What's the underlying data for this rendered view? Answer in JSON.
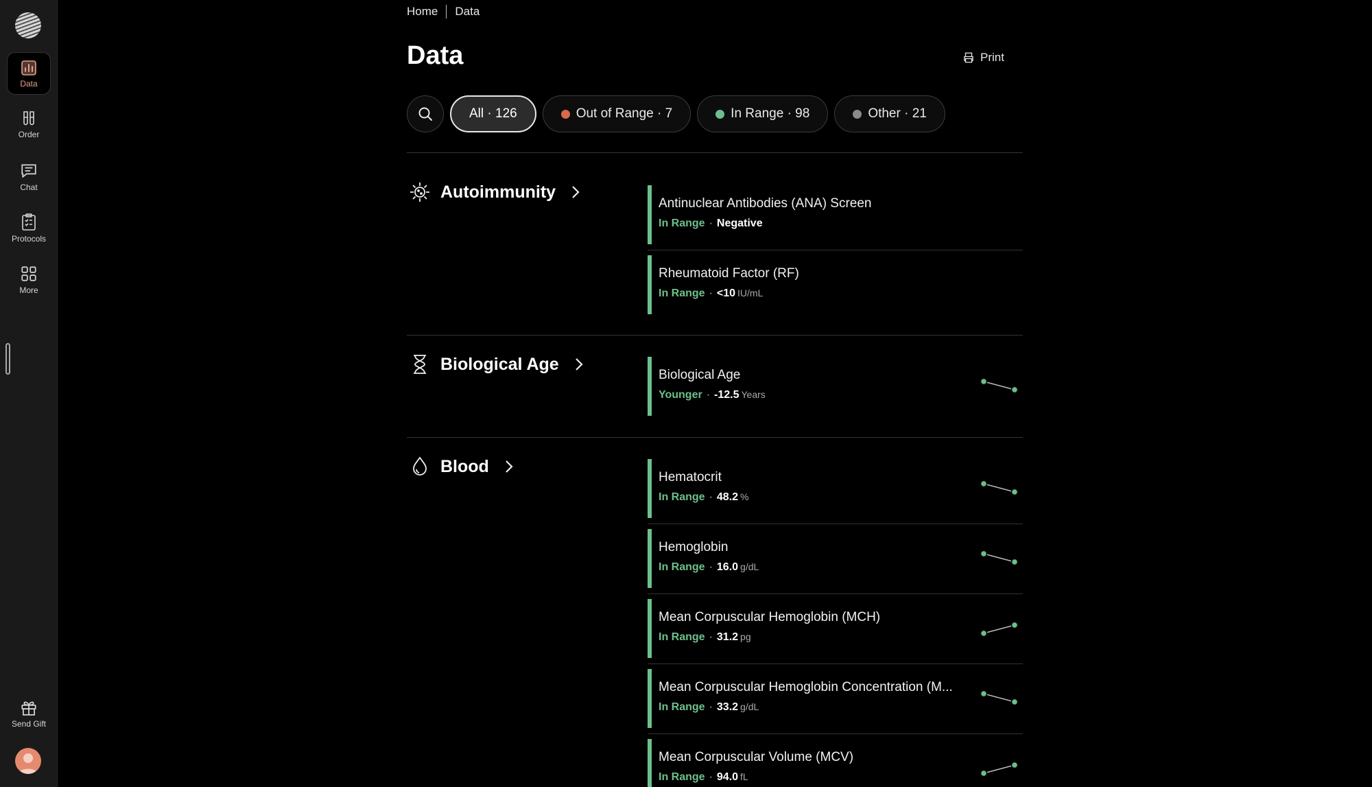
{
  "nav": {
    "items": [
      {
        "label": "Data",
        "icon": "chart-icon"
      },
      {
        "label": "Order",
        "icon": "test-tubes-icon"
      },
      {
        "label": "Chat",
        "icon": "chat-icon"
      },
      {
        "label": "Protocols",
        "icon": "clipboard-icon"
      },
      {
        "label": "More",
        "icon": "grid-icon"
      }
    ],
    "send_gift": "Send Gift"
  },
  "breadcrumb": {
    "home": "Home",
    "current": "Data"
  },
  "page_title": "Data",
  "print_label": "Print",
  "filters": [
    {
      "label": "All · 126",
      "active": true
    },
    {
      "label": "Out of Range · 7",
      "color": "#d9694a"
    },
    {
      "label": "In Range · 98",
      "color": "#6cc08b"
    },
    {
      "label": "Other · 21",
      "color": "#8a8a8a"
    }
  ],
  "categories": [
    {
      "name": "Autoimmunity",
      "icon": "sun-virus-icon",
      "items": [
        {
          "name": "Antinuclear Antibodies (ANA) Screen",
          "status": "In Range",
          "value": "Negative",
          "unit": ""
        },
        {
          "name": "Rheumatoid Factor (RF)",
          "status": "In Range",
          "value": "<10",
          "unit": "IU/mL"
        }
      ]
    },
    {
      "name": "Biological Age",
      "icon": "hourglass-icon",
      "items": [
        {
          "name": "Biological Age",
          "status": "Younger",
          "value": "-12.5",
          "unit": "Years",
          "trend": "down"
        }
      ]
    },
    {
      "name": "Blood",
      "icon": "drop-icon",
      "items": [
        {
          "name": "Hematocrit",
          "status": "In Range",
          "value": "48.2",
          "unit": "%",
          "trend": "down"
        },
        {
          "name": "Hemoglobin",
          "status": "In Range",
          "value": "16.0",
          "unit": "g/dL",
          "trend": "down"
        },
        {
          "name": "Mean Corpuscular Hemoglobin (MCH)",
          "status": "In Range",
          "value": "31.2",
          "unit": "pg",
          "trend": "up"
        },
        {
          "name": "Mean Corpuscular Hemoglobin Concentration (M...",
          "status": "In Range",
          "value": "33.2",
          "unit": "g/dL",
          "trend": "down"
        },
        {
          "name": "Mean Corpuscular Volume (MCV)",
          "status": "In Range",
          "value": "94.0",
          "unit": "fL",
          "trend": "up"
        }
      ]
    }
  ],
  "colors": {
    "in_range": "#6cc08b",
    "out_of_range": "#d9694a",
    "other": "#8a8a8a",
    "accent": "#e6a08a"
  }
}
